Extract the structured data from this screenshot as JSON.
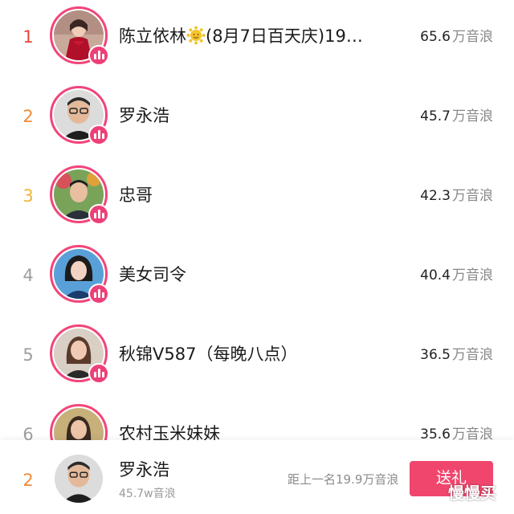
{
  "colors": {
    "rank_1": "#e8453c",
    "rank_2": "#f08a3a",
    "rank_3": "#f1b43a",
    "rank_other": "#9e9e9e",
    "avatar_ring": "#f2457a",
    "live_badge": "#ee3f78",
    "gift_button": "#f0466d"
  },
  "ranking": [
    {
      "rank": "1",
      "name": "陈立依林",
      "name_suffix": "(8月7日百天庆)19…",
      "has_emoji": true,
      "emoji": "sun-face-icon",
      "value": "65.6",
      "unit": "万音浪"
    },
    {
      "rank": "2",
      "name": "罗永浩",
      "value": "45.7",
      "unit": "万音浪"
    },
    {
      "rank": "3",
      "name": "忠哥",
      "value": "42.3",
      "unit": "万音浪"
    },
    {
      "rank": "4",
      "name": "美女司令",
      "value": "40.4",
      "unit": "万音浪"
    },
    {
      "rank": "5",
      "name": "秋锦V587（每晚八点）",
      "value": "36.5",
      "unit": "万音浪"
    },
    {
      "rank": "6",
      "name": "农村玉米妹妹",
      "value": "35.6",
      "unit": "万音浪"
    }
  ],
  "my_rank": {
    "rank": "2",
    "name": "罗永浩",
    "sub": "45.7w音浪",
    "gap_text": "距上一名19.9万音浪",
    "gift_label": "送礼"
  },
  "watermark": "慢慢买"
}
